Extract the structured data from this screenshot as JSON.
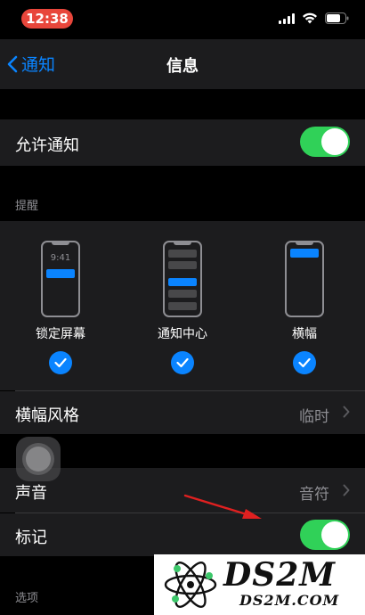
{
  "status_bar": {
    "time": "12:38",
    "time_pill_color": "#e8463b"
  },
  "nav": {
    "back_label": "通知",
    "title": "信息"
  },
  "allow_notifications": {
    "label": "允许通知",
    "enabled": true
  },
  "alerts": {
    "header": "提醒",
    "options": [
      {
        "label": "锁定屏幕",
        "lock_time": "9:41",
        "checked": true
      },
      {
        "label": "通知中心",
        "checked": true
      },
      {
        "label": "横幅",
        "checked": true
      }
    ]
  },
  "banner_style": {
    "label": "横幅风格",
    "value": "临时"
  },
  "sounds": {
    "label": "声音",
    "value": "音符"
  },
  "badges": {
    "label": "标记",
    "enabled": true
  },
  "options_section": {
    "header": "选项"
  },
  "watermark": {
    "main": "DS2M",
    "sub": "DS2M.COM"
  },
  "colors": {
    "accent": "#0a84ff",
    "toggle_on": "#30d158",
    "annotation_arrow": "#e02020"
  }
}
